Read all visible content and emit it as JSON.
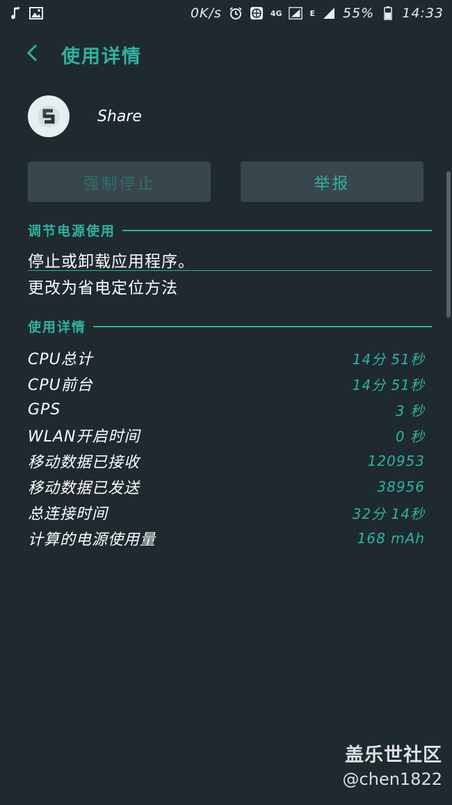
{
  "status_bar": {
    "net_speed": "0K/s",
    "network_type": "4G",
    "network_type_2": "E",
    "battery": "55%",
    "time": "14:33"
  },
  "header": {
    "title": "使用详情"
  },
  "app": {
    "name": "Share"
  },
  "buttons": {
    "force_stop": "强制停止",
    "report": "举报"
  },
  "power_section": {
    "title": "调节电源使用",
    "items": [
      "停止或卸载应用程序。",
      "更改为省电定位方法"
    ]
  },
  "details_section": {
    "title": "使用详情",
    "rows": [
      {
        "label": "CPU总计",
        "value": "14分 51秒"
      },
      {
        "label": "CPU前台",
        "value": "14分 51秒"
      },
      {
        "label": "GPS",
        "value": "3 秒"
      },
      {
        "label": "WLAN开启时间",
        "value": "0 秒"
      },
      {
        "label": "移动数据已接收",
        "value": "120953"
      },
      {
        "label": "移动数据已发送",
        "value": "38956"
      },
      {
        "label": "总连接时间",
        "value": "32分 14秒"
      },
      {
        "label": "计算的电源使用量",
        "value": "168 mAh"
      }
    ]
  },
  "watermark": {
    "brand": "盖乐世社区",
    "user": "@chen1822"
  },
  "colors": {
    "accent": "#2db3a0",
    "background": "#1f2a30",
    "button": "#3a464d"
  }
}
